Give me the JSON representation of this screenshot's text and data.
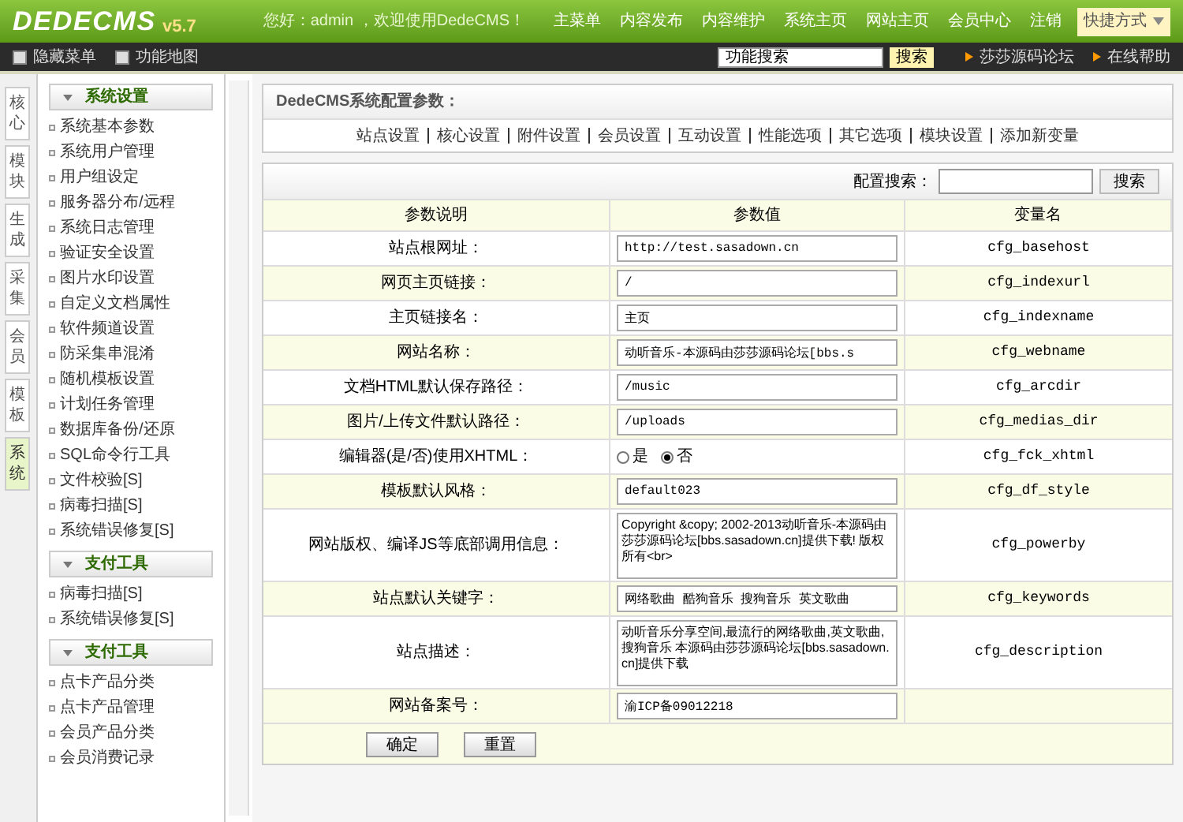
{
  "header": {
    "logo": "DEDECMS",
    "version": "v5.7",
    "greeting": "您好：admin ，欢迎使用DedeCMS！",
    "nav": [
      "主菜单",
      "内容发布",
      "内容维护",
      "系统主页",
      "网站主页",
      "会员中心",
      "注销"
    ],
    "shortcut": "快捷方式"
  },
  "toolbar": {
    "links": [
      "隐藏菜单",
      "功能地图"
    ],
    "search": {
      "value": "功能搜索"
    },
    "search_button": "搜索",
    "right_links": [
      "莎莎源码论坛",
      "在线帮助"
    ]
  },
  "side_tabs": [
    {
      "label": "核心",
      "selected": false
    },
    {
      "label": "模块",
      "selected": false
    },
    {
      "label": "生成",
      "selected": false
    },
    {
      "label": "采集",
      "selected": false
    },
    {
      "label": "会员",
      "selected": false
    },
    {
      "label": "模板",
      "selected": false
    },
    {
      "label": "系统",
      "selected": true
    }
  ],
  "menu_groups": [
    {
      "title": "系统设置",
      "items": [
        "系统基本参数",
        "系统用户管理",
        "用户组设定",
        "服务器分布/远程",
        "系统日志管理",
        "验证安全设置",
        "图片水印设置",
        "自定义文档属性",
        "软件频道设置",
        "防采集串混淆",
        "随机模板设置",
        "计划任务管理",
        "数据库备份/还原",
        "SQL命令行工具",
        "文件校验[S]",
        "病毒扫描[S]",
        "系统错误修复[S]"
      ]
    },
    {
      "title": "支付工具",
      "items": [
        "病毒扫描[S]",
        "系统错误修复[S]"
      ]
    },
    {
      "title": "支付工具",
      "items": [
        "点卡产品分类",
        "点卡产品管理",
        "会员产品分类",
        "会员消费记录"
      ]
    }
  ],
  "panel": {
    "title": "DedeCMS系统配置参数：",
    "tabs": [
      "站点设置",
      "核心设置",
      "附件设置",
      "会员设置",
      "互动设置",
      "性能选项",
      "其它选项",
      "模块设置",
      "添加新变量"
    ],
    "search_label": "配置搜索：",
    "search_button": "搜索",
    "columns": [
      "参数说明",
      "参数值",
      "变量名"
    ],
    "rows": [
      {
        "kind": "text",
        "label": "站点根网址：",
        "value": "http://test.sasadown.cn",
        "var": "cfg_basehost"
      },
      {
        "kind": "text",
        "label": "网页主页链接：",
        "value": "/",
        "var": "cfg_indexurl"
      },
      {
        "kind": "text",
        "label": "主页链接名：",
        "value": "主页",
        "var": "cfg_indexname"
      },
      {
        "kind": "text",
        "label": "网站名称：",
        "value": "动听音乐-本源码由莎莎源码论坛[bbs.s",
        "var": "cfg_webname"
      },
      {
        "kind": "text",
        "label": "文档HTML默认保存路径：",
        "value": "/music",
        "var": "cfg_arcdir"
      },
      {
        "kind": "text",
        "label": "图片/上传文件默认路径：",
        "value": "/uploads",
        "var": "cfg_medias_dir"
      },
      {
        "kind": "radio",
        "label": "编辑器(是/否)使用XHTML：",
        "options": [
          {
            "label": "是",
            "selected": false
          },
          {
            "label": "否",
            "selected": true
          }
        ],
        "var": "cfg_fck_xhtml"
      },
      {
        "kind": "text",
        "label": "模板默认风格：",
        "value": "default023",
        "var": "cfg_df_style"
      },
      {
        "kind": "textarea",
        "label": "网站版权、编译JS等底部调用信息：",
        "value": "Copyright &copy; 2002-2013动听音乐-本源码由莎莎源码论坛[bbs.sasadown.cn]提供下载! 版权所有<br>",
        "var": "cfg_powerby"
      },
      {
        "kind": "text",
        "label": "站点默认关键字：",
        "value": "网络歌曲 酷狗音乐 搜狗音乐 英文歌曲",
        "var": "cfg_keywords"
      },
      {
        "kind": "textarea",
        "label": "站点描述：",
        "value": "动听音乐分享空间,最流行的网络歌曲,英文歌曲,搜狗音乐 本源码由莎莎源码论坛[bbs.sasadown.cn]提供下载",
        "var": "cfg_description"
      },
      {
        "kind": "text",
        "label": "网站备案号：",
        "value": "渝ICP备09012218"
      }
    ],
    "buttons": [
      "确定",
      "重置"
    ]
  }
}
